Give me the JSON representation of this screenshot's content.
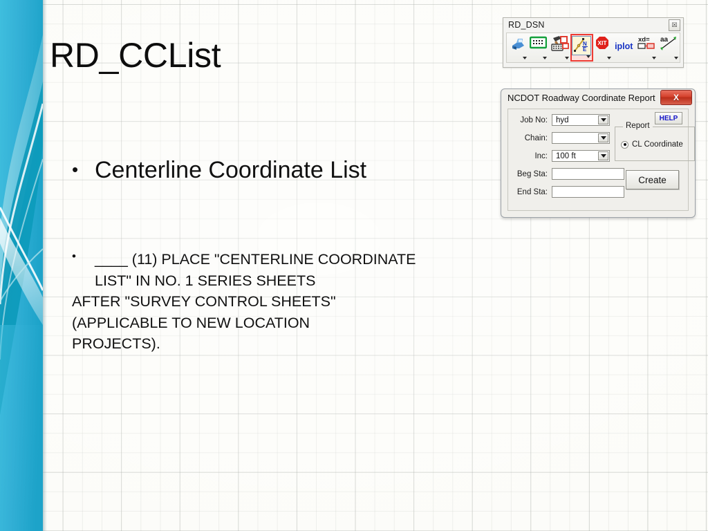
{
  "slide": {
    "title": "RD_CCList",
    "bullets": [
      {
        "marker": "•",
        "text": "Centerline Coordinate List"
      },
      {
        "marker": "•",
        "line1": "____ (11) PLACE \"CENTERLINE COORDINATE",
        "line2": "LIST\" IN NO. 1 SERIES SHEETS",
        "line3": "AFTER \"SURVEY CONTROL SHEETS\"",
        "line4": "(APPLICABLE TO NEW LOCATION",
        "line5": "PROJECTS)."
      }
    ]
  },
  "toolbar": {
    "title": "RD_DSN",
    "close_glyph": "☒",
    "tools": [
      {
        "name": "print-plotter-icon",
        "has_caret": true,
        "selected": false
      },
      {
        "name": "grid-table-icon",
        "has_caret": true,
        "selected": false
      },
      {
        "name": "hammer-keyboard-icon",
        "has_caret": true,
        "selected": false
      },
      {
        "name": "coordinate-report-icon",
        "has_caret": true,
        "selected": true
      },
      {
        "name": "xit-stop-icon",
        "label": "XIT",
        "has_caret": true,
        "selected": false
      },
      {
        "name": "iplot-icon",
        "label": "iplot",
        "has_caret": false,
        "selected": false
      },
      {
        "name": "xd-dimension-icon",
        "label": "xd=",
        "has_caret": true,
        "selected": false
      },
      {
        "name": "aa-text-icon",
        "label": "aa",
        "has_caret": true,
        "selected": false
      }
    ],
    "selection_color": "#ee3b33"
  },
  "dialog": {
    "title": "NCDOT Roadway Coordinate Report",
    "close_label": "X",
    "close_color": "#d4412c",
    "help_label": "HELP",
    "help_color": "#1414c8",
    "fields": [
      {
        "label": "Job No:",
        "type": "combo",
        "value": "hyd"
      },
      {
        "label": "Chain:",
        "type": "combo",
        "value": ""
      },
      {
        "label": "Inc:",
        "type": "combo",
        "value": "100 ft"
      },
      {
        "label": "Beg Sta:",
        "type": "text",
        "value": ""
      },
      {
        "label": "End Sta:",
        "type": "text",
        "value": ""
      }
    ],
    "report_group": {
      "legend": "Report",
      "option_label": "CL Coordinate",
      "selected": true
    },
    "create_label": "Create"
  },
  "theme": {
    "band_color": "#35b2d8",
    "band_deep": "#0d8fb0",
    "page_bg": "#fcfcf8"
  }
}
